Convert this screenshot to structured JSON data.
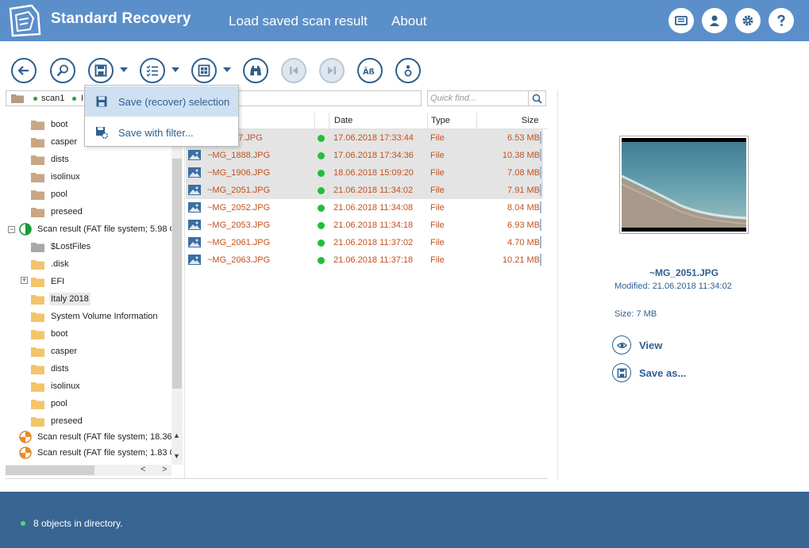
{
  "header": {
    "app_title": "Standard Recovery",
    "links": [
      "Load saved scan result",
      "About"
    ],
    "buttons": [
      "log-icon",
      "user-icon",
      "gear-icon",
      "help-icon"
    ],
    "bg_color": "#5b8fc9"
  },
  "toolbar": {
    "buttons": [
      "back-icon",
      "search-icon",
      "save-icon",
      "checklist-icon",
      "view-mode-icon",
      "binoculars-icon",
      "previous-icon",
      "next-icon",
      "case-sensitive-icon",
      "info-icon"
    ]
  },
  "menu": {
    "items": [
      {
        "label": "Save (recover) selection",
        "icon": "save-icon",
        "highlighted": true
      },
      {
        "label": "Save with filter...",
        "icon": "save-filter-icon",
        "highlighted": false
      }
    ]
  },
  "path": {
    "segments": [
      "scan1",
      "I"
    ]
  },
  "quick_find": {
    "placeholder": "Quick find..."
  },
  "tree": {
    "items": [
      {
        "label": "boot"
      },
      {
        "label": "casper"
      },
      {
        "label": "dists"
      },
      {
        "label": "isolinux"
      },
      {
        "label": "pool"
      },
      {
        "label": "preseed"
      },
      {
        "label": "Scan result (FAT file system; 5.98 G"
      },
      {
        "label": "$LostFiles"
      },
      {
        "label": ".disk"
      },
      {
        "label": "EFI"
      },
      {
        "label": "Italy 2018"
      },
      {
        "label": "System Volume Information"
      },
      {
        "label": "boot"
      },
      {
        "label": "casper"
      },
      {
        "label": "dists"
      },
      {
        "label": "isolinux"
      },
      {
        "label": "pool"
      },
      {
        "label": "preseed"
      },
      {
        "label": "Scan result (FAT file system; 18.36"
      },
      {
        "label": "Scan result (FAT file system; 1.83 G"
      }
    ]
  },
  "file_list": {
    "columns": [
      "Date",
      "Type",
      "Size"
    ],
    "rows": [
      {
        "name": "87.JPG",
        "date": "17.06.2018 17:33:44",
        "type": "File",
        "size": "6.53 MB",
        "selected": true
      },
      {
        "name": "~MG_1888.JPG",
        "date": "17.06.2018 17:34:36",
        "type": "File",
        "size": "10.38 MB",
        "selected": true
      },
      {
        "name": "~MG_1906.JPG",
        "date": "18.06.2018 15:09:20",
        "type": "File",
        "size": "7.08 MB",
        "selected": true
      },
      {
        "name": "~MG_2051.JPG",
        "date": "21.06.2018 11:34:02",
        "type": "File",
        "size": "7.91 MB",
        "selected": true
      },
      {
        "name": "~MG_2052.JPG",
        "date": "21.06.2018 11:34:08",
        "type": "File",
        "size": "8.04 MB",
        "selected": false
      },
      {
        "name": "~MG_2053.JPG",
        "date": "21.06.2018 11:34:18",
        "type": "File",
        "size": "6.93 MB",
        "selected": false
      },
      {
        "name": "~MG_2061.JPG",
        "date": "21.06.2018 11:37:02",
        "type": "File",
        "size": "4.70 MB",
        "selected": false
      },
      {
        "name": "~MG_2063.JPG",
        "date": "21.06.2018 11:37:18",
        "type": "File",
        "size": "10.21 MB",
        "selected": false
      }
    ],
    "name_color": "#c4501c",
    "status_color": "#1fbf3a"
  },
  "preview": {
    "filename": "~MG_2051.JPG",
    "modified": "Modified: 21.06.2018 11:34:02",
    "size": "Size: 7 MB",
    "actions": [
      "View",
      "Save as..."
    ]
  },
  "status": {
    "text": "8 objects in directory.",
    "bg_color": "#396592"
  }
}
